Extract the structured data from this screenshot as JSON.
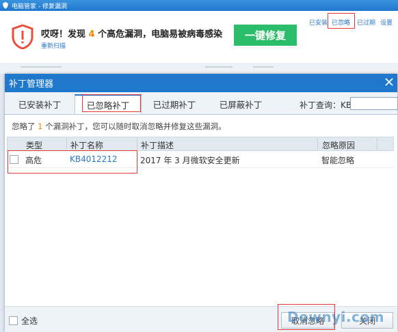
{
  "background_window": {
    "title": "电脑管家 - 修复漏洞",
    "alert_prefix": "哎呀！发现",
    "alert_count": "4",
    "alert_suffix": "个高危漏洞，电脑易被病毒感染",
    "rescan_link": "重新扫描",
    "fix_button": "一键修复",
    "tabs": [
      "已安装",
      "已忽略",
      "已过期",
      "设置"
    ]
  },
  "dialog": {
    "title": "补丁管理器",
    "tabs": [
      "已安装补丁",
      "已忽略补丁",
      "已过期补丁",
      "已屏蔽补丁"
    ],
    "active_tab": "已忽略补丁",
    "search_label": "补丁查询：KB",
    "search_value": "",
    "notice_prefix": "忽略了",
    "notice_count": "1",
    "notice_suffix": "个漏洞补丁，您可以随时取消忽略并修复这些漏洞。",
    "columns": [
      "类型",
      "补丁名称",
      "补丁描述",
      "忽略原因"
    ],
    "rows": [
      {
        "type": "高危",
        "name": "KB4012212",
        "description": "2017 年 3 月微软安全更新",
        "reason": "智能忽略"
      }
    ],
    "select_all_label": "全选",
    "cancel_button": "取消忽略",
    "close_button": "关闭"
  },
  "watermark": "Downyi.com",
  "colors": {
    "accent": "#1f78cc",
    "warning": "#f08a00",
    "fix_button": "#2cbd6a",
    "highlight_box": "#e53935"
  }
}
